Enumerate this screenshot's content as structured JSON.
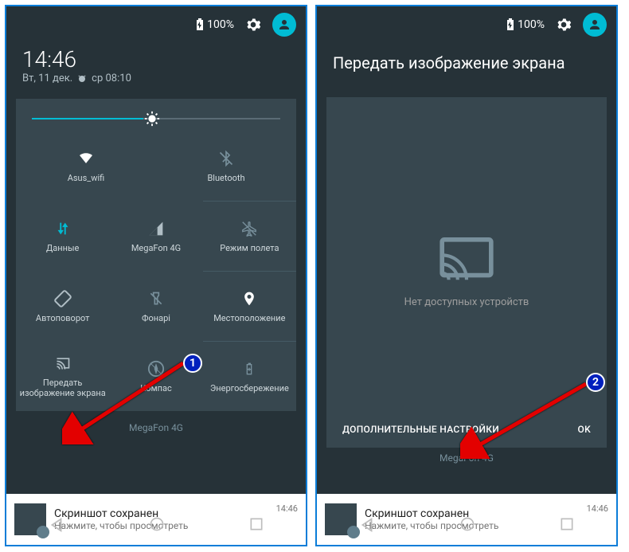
{
  "status": {
    "battery_pct": "100%"
  },
  "datetime": {
    "time": "14:46",
    "date": "Вт, 11 дек.",
    "alarm": "ср 08:10"
  },
  "qs": {
    "wifi": "Asus_wifi",
    "bluetooth": "Bluetooth",
    "data": "Данные",
    "signal": "MegaFon 4G",
    "airplane": "Режим полета",
    "autorotate": "Автоповорот",
    "flashlight": "Фонарі",
    "location": "Местоположение",
    "cast": "Передать изображение экрана",
    "compass": "Компас",
    "battery_saver": "Энергосбережение"
  },
  "carrier": "MegaFon 4G",
  "notif": {
    "title": "Скриншот сохранен",
    "sub": "Нажмите, чтобы просмотреть",
    "time": "14:46"
  },
  "cast_screen": {
    "title": "Передать изображение экрана",
    "empty": "Нет доступных устройств",
    "more": "ДОПОЛНИТЕЛЬНЫЕ НАСТРОЙКИ",
    "ok": "OK"
  },
  "callouts": {
    "c1": "1",
    "c2": "2"
  }
}
